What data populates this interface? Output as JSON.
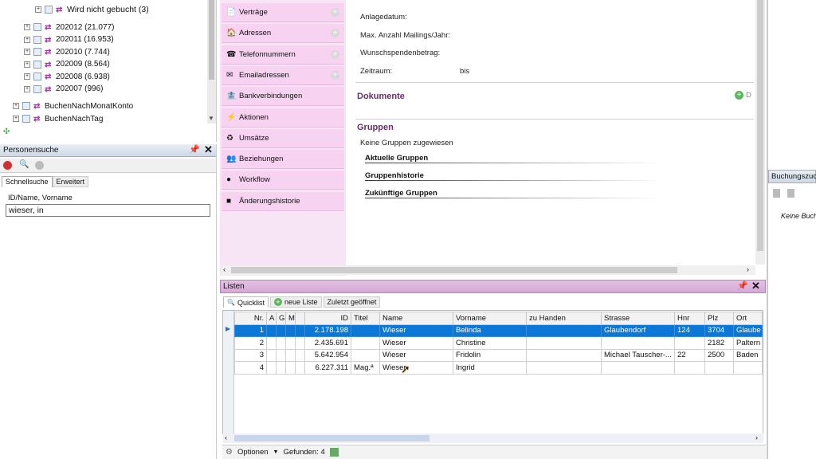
{
  "tree": {
    "partial_top": "Wird nicht gebucht (3)",
    "months": [
      "202012 (21.077)",
      "202011 (16.953)",
      "202010 (7.744)",
      "202009 (8.564)",
      "202008 (6.938)",
      "202007 (996)"
    ],
    "roots": [
      "BuchenNachMonatKonto",
      "BuchenNachTag"
    ]
  },
  "personensuche": {
    "title": "Personensuche",
    "tabs": [
      "Schnellsuche",
      "Erweitert"
    ],
    "field_label": "ID/Name, Vorname",
    "field_value": "wieser, in"
  },
  "nav": {
    "items": [
      "Verträge",
      "Adressen",
      "Telefonnummern",
      "Emailadressen",
      "Bankverbindungen",
      "Aktionen",
      "Umsätze",
      "Beziehungen",
      "Workflow",
      "Änderungshistorie"
    ]
  },
  "details": {
    "labels": [
      "Anlagedatum:",
      "Max. Anzahl Mailings/Jahr:",
      "Wunschspendenbetrag:",
      "Zeitraum:"
    ],
    "zeitraum_bis": "bis",
    "dokumente": "Dokumente",
    "dokumente_btn": "D",
    "gruppen": "Gruppen",
    "keine_gruppen": "Keine Gruppen zugewiesen",
    "gruppen_links": [
      "Aktuelle Gruppen",
      "Gruppenhistorie",
      "Zukünftige Gruppen"
    ]
  },
  "buchung": {
    "title": "Buchungszuo",
    "empty": "Keine Buch"
  },
  "listen": {
    "title": "Listen",
    "tabs": [
      "Quicklist",
      "neue Liste",
      "Zuletzt geöffnet"
    ],
    "columns": [
      "Nr.",
      "A",
      "G",
      "M",
      "",
      "ID",
      "Titel",
      "Name",
      "Vorname",
      "zu Handen",
      "Strasse",
      "Hnr",
      "Plz",
      "Ort"
    ],
    "rows": [
      {
        "nr": "1",
        "id": "2.178.198",
        "titel": "",
        "name": "Wieser",
        "vorname": "Belinda",
        "zuhanden": "",
        "strasse": "Glaubendorf",
        "hnr": "124",
        "plz": "3704",
        "ort": "Glaube"
      },
      {
        "nr": "2",
        "id": "2.435.691",
        "titel": "",
        "name": "Wieser",
        "vorname": "Christine",
        "zuhanden": "",
        "strasse": "",
        "hnr": "",
        "plz": "2182",
        "ort": "Paltern"
      },
      {
        "nr": "3",
        "id": "5.642.954",
        "titel": "",
        "name": "Wieser",
        "vorname": "Fridolin",
        "zuhanden": "",
        "strasse": "Michael Tauscher-...",
        "hnr": "22",
        "plz": "2500",
        "ort": "Baden"
      },
      {
        "nr": "4",
        "id": "6.227.311",
        "titel": "Mag.ª",
        "name": "Wieser",
        "vorname": "Ingrid",
        "zuhanden": "",
        "strasse": "",
        "hnr": "",
        "plz": "",
        "ort": ""
      }
    ],
    "footer_optionen": "Optionen",
    "footer_gefunden": "Gefunden: 4"
  },
  "colors": {
    "accent": "#0b78d7",
    "nav_bg": "#f7d2f1",
    "section": "#6b2d6b",
    "header": "#d6a9d6"
  }
}
